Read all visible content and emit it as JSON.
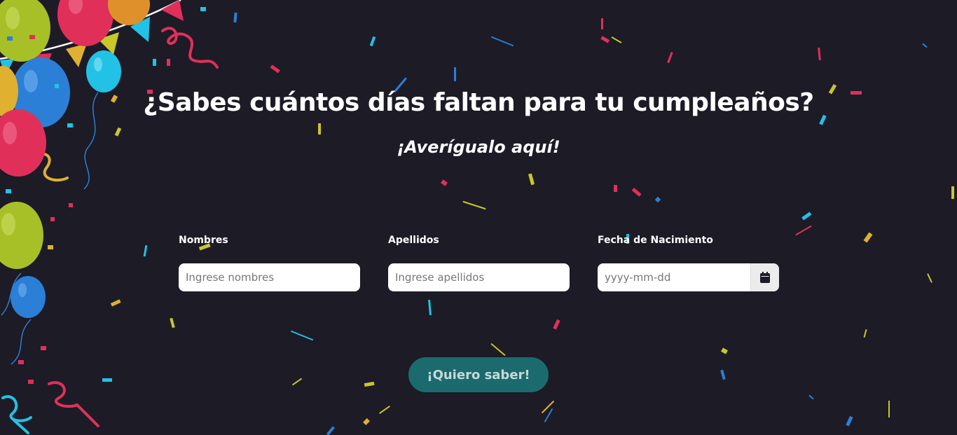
{
  "heading": {
    "title": "¿Sabes cuántos días faltan para tu cumpleaños?",
    "subtitle": "¡Averígualo aquí!"
  },
  "form": {
    "nombres": {
      "label": "Nombres",
      "placeholder": "Ingrese nombres",
      "value": ""
    },
    "apellidos": {
      "label": "Apellidos",
      "placeholder": "Ingrese apellidos",
      "value": ""
    },
    "fecha": {
      "label": "Fecha de Nacimiento",
      "placeholder": "yyyy-mm-dd",
      "value": "",
      "icon": "calendar-icon"
    },
    "submit_label": "¡Quiero saber!"
  },
  "colors": {
    "background": "#1c1b26",
    "button": "#1b6b6e",
    "confetti": [
      "#e0305a",
      "#22c2e6",
      "#c8c828",
      "#2b7fd6",
      "#e0b030"
    ]
  }
}
